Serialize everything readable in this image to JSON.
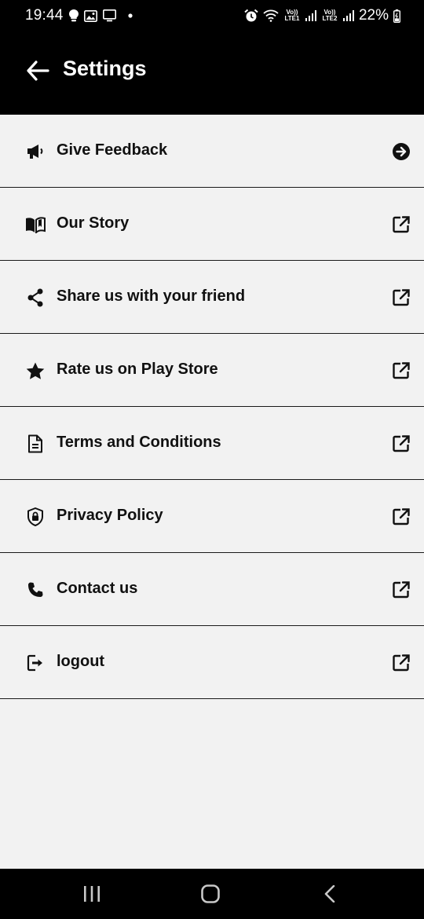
{
  "status_bar": {
    "time": "19:44",
    "battery": "22%",
    "sim1_tag": "Vo)) LTE1",
    "sim2_tag": "Vo)) LTE2",
    "left_icons": [
      "bulb-icon",
      "image-icon",
      "screen-icon",
      "dot-icon"
    ],
    "right_icons": [
      "alarm-icon",
      "wifi-icon",
      "signal-icon",
      "battery-icon"
    ]
  },
  "app_bar": {
    "title": "Settings",
    "back_icon": "arrow-left-icon"
  },
  "menu": {
    "items": [
      {
        "label": "Give Feedback",
        "icon": "megaphone-icon",
        "trailing": "arrow-right-circle-icon"
      },
      {
        "label": "Our Story",
        "icon": "book-icon",
        "trailing": "external-link-icon"
      },
      {
        "label": "Share us with your friend",
        "icon": "share-icon",
        "trailing": "external-link-icon"
      },
      {
        "label": "Rate us on Play Store",
        "icon": "star-icon",
        "trailing": "external-link-icon"
      },
      {
        "label": "Terms and Conditions",
        "icon": "document-icon",
        "trailing": "external-link-icon"
      },
      {
        "label": "Privacy Policy",
        "icon": "shield-lock-icon",
        "trailing": "external-link-icon"
      },
      {
        "label": "Contact us",
        "icon": "phone-icon",
        "trailing": "external-link-icon"
      },
      {
        "label": "logout",
        "icon": "logout-icon",
        "trailing": "external-link-icon"
      }
    ]
  },
  "nav_bar": {
    "buttons": [
      "recent-apps-icon",
      "home-icon",
      "back-icon"
    ]
  },
  "colors": {
    "bar_background": "#000000",
    "page_background": "#f2f2f2",
    "text": "#111111",
    "divider": "#1a1a1a"
  }
}
